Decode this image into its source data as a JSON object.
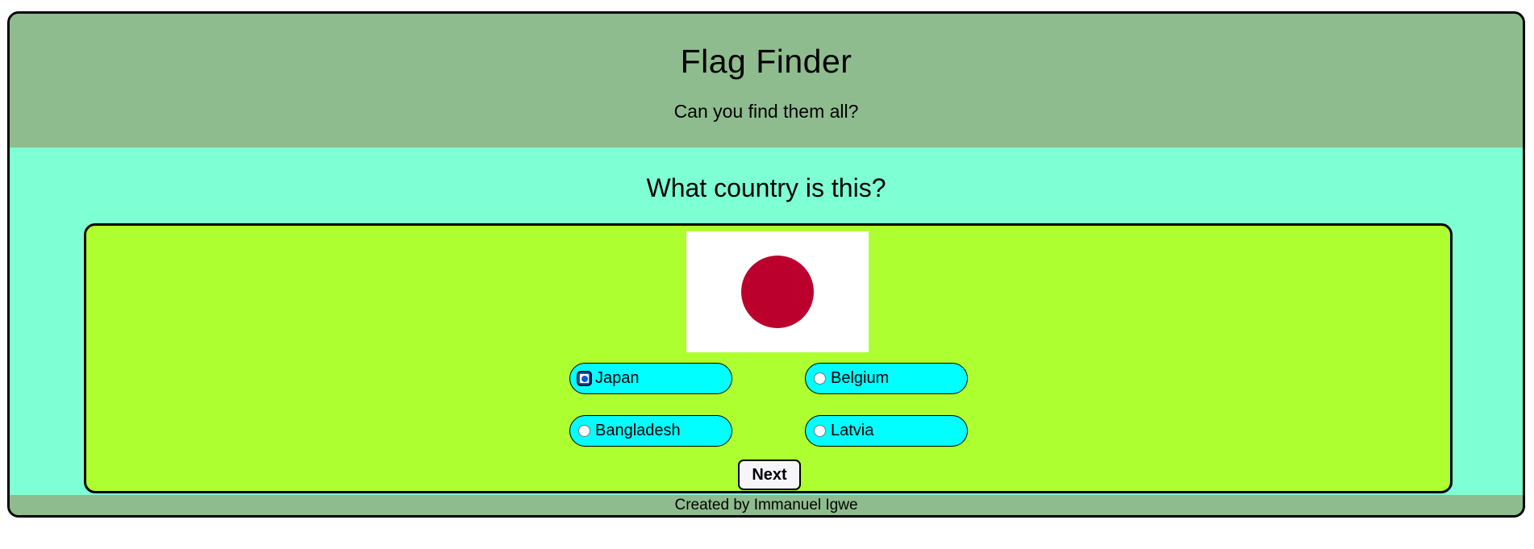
{
  "header": {
    "title": "Flag Finder",
    "subtitle": "Can you find them all?"
  },
  "quiz": {
    "question": "What country is this?",
    "flag": {
      "icon": "japan-flag-icon",
      "field_color": "#ffffff",
      "disc_color": "#bc002d"
    },
    "options": [
      {
        "label": "Japan",
        "selected": true
      },
      {
        "label": "Belgium",
        "selected": false
      },
      {
        "label": "Bangladesh",
        "selected": false
      },
      {
        "label": "Latvia",
        "selected": false
      }
    ],
    "next_label": "Next"
  },
  "footer": {
    "text": "Created by Immanuel Igwe"
  },
  "colors": {
    "header_bg": "#8fbc8f",
    "page_bg": "#7fffd4",
    "card_bg": "#adff2f",
    "option_bg": "#00ffff"
  }
}
